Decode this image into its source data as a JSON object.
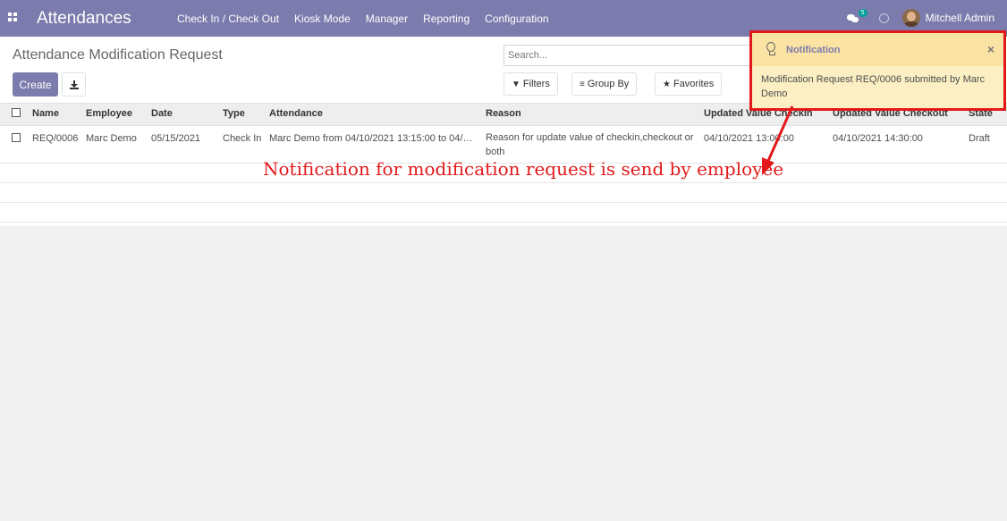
{
  "navbar": {
    "app_title": "Attendances",
    "menu": [
      "Check In / Check Out",
      "Kiosk Mode",
      "Manager",
      "Reporting",
      "Configuration"
    ],
    "chat_badge": "5",
    "user_name": "Mitchell Admin"
  },
  "control_panel": {
    "breadcrumb": "Attendance Modification Request",
    "create_label": "Create",
    "search_placeholder": "Search...",
    "filters_label": "Filters",
    "group_by_label": "Group By",
    "favorites_label": "Favorites"
  },
  "table": {
    "columns": [
      "Name",
      "Employee",
      "Date",
      "Type",
      "Attendance",
      "Reason",
      "Updated Value Checkin",
      "Updated Value Checkout",
      "State"
    ],
    "rows": [
      {
        "name": "REQ/0006",
        "employee": "Marc Demo",
        "date": "05/15/2021",
        "type": "Check In",
        "attendance": "Marc Demo from 04/10/2021 13:15:00 to 04/…",
        "reason": "Reason for update value of checkin,checkout or both",
        "updated_checkin": "04/10/2021 13:00:00",
        "updated_checkout": "04/10/2021 14:30:00",
        "state": "Draft"
      }
    ]
  },
  "notification": {
    "title": "Notification",
    "close": "×",
    "message": "Modification Request REQ/0006 submitted by Marc Demo"
  },
  "annotation": {
    "text": "Notification for modification request is send by employee",
    "color": "#e2191b"
  },
  "colors": {
    "brand": "#7c7bad",
    "highlight": "#e2191b",
    "notification_bg": "#fcefc3"
  }
}
